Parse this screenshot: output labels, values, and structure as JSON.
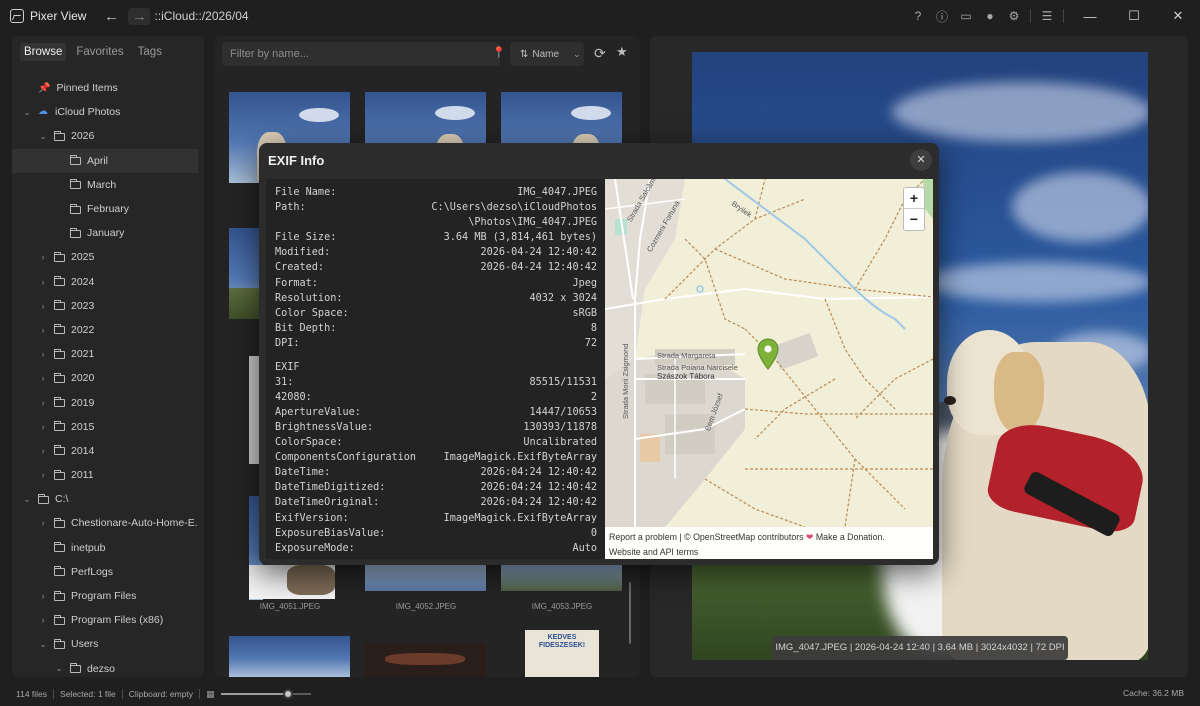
{
  "app": {
    "title": "Pixer View",
    "path": "::iCloud::/2026/04"
  },
  "titlebar": {
    "icons": [
      "help-icon",
      "info-icon",
      "monitor-icon",
      "circle-icon",
      "gear-icon",
      "menu-icon"
    ],
    "icon_glyphs": [
      "?",
      "ⓘ",
      "▭",
      "●",
      "⚙",
      "☰"
    ],
    "back_glyph": "←",
    "forward_glyph": "→",
    "minimize_glyph": "—",
    "maximize_glyph": "☐",
    "close_glyph": "✕"
  },
  "sidebar": {
    "tabs": [
      "Browse",
      "Favorites",
      "Tags"
    ],
    "tree": [
      {
        "label": "Pinned Items",
        "indent": 0,
        "icon": "pin",
        "chev": ""
      },
      {
        "label": "iCloud Photos",
        "indent": 0,
        "icon": "cloud",
        "chev": "v"
      },
      {
        "label": "2026",
        "indent": 1,
        "icon": "folder",
        "chev": "v"
      },
      {
        "label": "April",
        "indent": 2,
        "icon": "folder",
        "chev": "",
        "selected": true
      },
      {
        "label": "March",
        "indent": 2,
        "icon": "folder",
        "chev": ""
      },
      {
        "label": "February",
        "indent": 2,
        "icon": "folder",
        "chev": ""
      },
      {
        "label": "January",
        "indent": 2,
        "icon": "folder",
        "chev": ""
      },
      {
        "label": "2025",
        "indent": 1,
        "icon": "folder",
        "chev": ">"
      },
      {
        "label": "2024",
        "indent": 1,
        "icon": "folder",
        "chev": ">"
      },
      {
        "label": "2023",
        "indent": 1,
        "icon": "folder",
        "chev": ">"
      },
      {
        "label": "2022",
        "indent": 1,
        "icon": "folder",
        "chev": ">"
      },
      {
        "label": "2021",
        "indent": 1,
        "icon": "folder",
        "chev": ">"
      },
      {
        "label": "2020",
        "indent": 1,
        "icon": "folder",
        "chev": ">"
      },
      {
        "label": "2019",
        "indent": 1,
        "icon": "folder",
        "chev": ">"
      },
      {
        "label": "2015",
        "indent": 1,
        "icon": "folder",
        "chev": ">"
      },
      {
        "label": "2014",
        "indent": 1,
        "icon": "folder",
        "chev": ">"
      },
      {
        "label": "2011",
        "indent": 1,
        "icon": "folder",
        "chev": ">"
      },
      {
        "label": "C:\\",
        "indent": 0,
        "icon": "folder",
        "chev": "v"
      },
      {
        "label": "Chestionare-Auto-Home-E...",
        "indent": 1,
        "icon": "folder",
        "chev": ">"
      },
      {
        "label": "inetpub",
        "indent": 1,
        "icon": "folder",
        "chev": ""
      },
      {
        "label": "PerfLogs",
        "indent": 1,
        "icon": "folder",
        "chev": ""
      },
      {
        "label": "Program Files",
        "indent": 1,
        "icon": "folder",
        "chev": ">"
      },
      {
        "label": "Program Files (x86)",
        "indent": 1,
        "icon": "folder",
        "chev": ">"
      },
      {
        "label": "Users",
        "indent": 1,
        "icon": "folder",
        "chev": "v"
      },
      {
        "label": "dezso",
        "indent": 2,
        "icon": "folder",
        "chev": "v"
      }
    ]
  },
  "browser": {
    "filter_placeholder": "Filter by name...",
    "sort_label": "Name",
    "sort_glyph": "⇅",
    "labels": [
      "IMG_4051.JPEG",
      "IMG_4052.JPEG",
      "IMG_4053.JPEG"
    ],
    "kedves_sign": "KEDVES FIDESZESEK!"
  },
  "preview": {
    "info": "IMG_4047.JPEG | 2026-04-24 12:40 | 3.64 MB | 3024x4032 | 72 DPI"
  },
  "statusbar": {
    "files": "114 files",
    "selected": "Selected: 1 file",
    "clipboard": "Clipboard: empty",
    "cache": "Cache: 36.2 MB",
    "zoom_fraction": 0.75
  },
  "dialog": {
    "title": "EXIF Info",
    "close_glyph": "✕",
    "file_info": [
      {
        "k": "File Name:",
        "v": "IMG_4047.JPEG"
      },
      {
        "k": "Path:",
        "v": "C:\\Users\\dezso\\iCloudPhotos\n\\Photos\\IMG_4047.JPEG",
        "multi": true
      },
      {
        "k": "File Size:",
        "v": "3.64 MB (3,814,461 bytes)"
      },
      {
        "k": "Modified:",
        "v": "2026-04-24 12:40:42"
      },
      {
        "k": "Created:",
        "v": "2026-04-24 12:40:42"
      },
      {
        "k": "Format:",
        "v": "Jpeg"
      },
      {
        "k": "Resolution:",
        "v": "4032 x 3024"
      },
      {
        "k": "Color Space:",
        "v": "sRGB"
      },
      {
        "k": "Bit Depth:",
        "v": "8"
      },
      {
        "k": "DPI:",
        "v": "72"
      }
    ],
    "exif_header": "EXIF",
    "exif": [
      {
        "k": "31:",
        "v": "85515/11531"
      },
      {
        "k": "42080:",
        "v": "2"
      },
      {
        "k": "ApertureValue:",
        "v": "14447/10653"
      },
      {
        "k": "BrightnessValue:",
        "v": "130393/11878"
      },
      {
        "k": "ColorSpace:",
        "v": "Uncalibrated"
      },
      {
        "k": "ComponentsConfiguration",
        "v": "ImageMagick.ExifByteArray"
      },
      {
        "k": "DateTime:",
        "v": "2026:04:24 12:40:42"
      },
      {
        "k": "DateTimeDigitized:",
        "v": "2026:04:24 12:40:42"
      },
      {
        "k": "DateTimeOriginal:",
        "v": "2026:04:24 12:40:42"
      },
      {
        "k": "ExifVersion:",
        "v": "ImageMagick.ExifByteArray"
      },
      {
        "k": "ExposureBiasValue:",
        "v": "0"
      },
      {
        "k": "ExposureMode:",
        "v": "Auto"
      }
    ],
    "map": {
      "zoom_in": "+",
      "zoom_out": "−",
      "attribution_1": "Report a problem | © OpenStreetMap contributors",
      "heart": "❤",
      "attribution_2": "Make a Donation.",
      "attribution_3": "Website and API terms",
      "labels": [
        "Strada Margareta",
        "Strada Poiana Narcisele",
        "Szászok Tábora",
        "Strada Morii Zsigmond",
        "Bem József",
        "Strada Salcâmilor",
        "Cozmeni Fortuna",
        "Bryilek"
      ]
    }
  }
}
